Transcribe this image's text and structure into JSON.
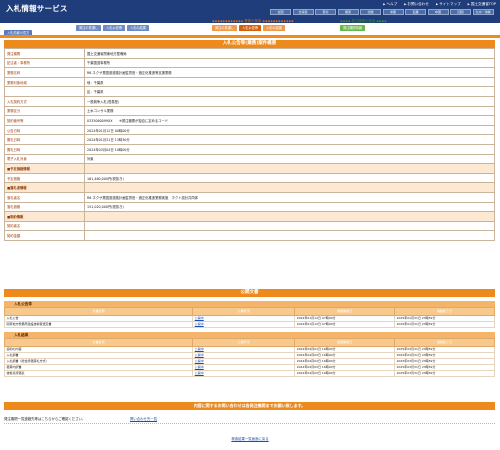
{
  "header": {
    "title": "入札情報サービス",
    "links": [
      "ヘルプ",
      "お問い合わせ",
      "サイトマップ",
      "国土交通省TOP"
    ],
    "regions": [
      "全国",
      "北海道",
      "東北",
      "関東",
      "北陸",
      "中部",
      "近畿",
      "中国",
      "四国",
      "九州・沖縄"
    ]
  },
  "nav": {
    "top_group": {
      "title": "★ 入札情報の見方 ★",
      "buttons": [
        "入札情報の見方"
      ]
    },
    "construction": {
      "title": "◆◆◆◆◆◆◆◆◆◆◆◆◆ 工事の検索 ◆◆◆◆◆◆◆◆◆◆◆◆◆",
      "buttons": [
        "発注の見通し",
        "入札公告等",
        "入札の結果"
      ]
    },
    "gyomu": {
      "title": "◆◆◆◆◆◆◆◆◆◆◆◆ 業務の検索 ◆◆◆◆◆◆◆◆◆◆◆◆",
      "buttons": [
        "発注の見通し",
        "入札公告等",
        "入札の結果"
      ],
      "selected": 1
    },
    "keiyaku": {
      "title": "◆◆◆◆ 発注機関の検索 ◆◆◆◆",
      "buttons": [
        "発注機関情報"
      ]
    }
  },
  "detail": {
    "title": "入札公告等(業務)案件概要",
    "rows": [
      {
        "label": "発注機関",
        "value": "国土交通省関東地方整備局",
        "section": false
      },
      {
        "label": "記注者・事務所",
        "value": "千葉国道事務所",
        "section": false
      },
      {
        "label": "業務名称",
        "value": "R6 ネクサ業図道道路計画監督官・適正化推進等支援業務",
        "section": false
      },
      {
        "label": "業務対象地域",
        "value": "他：千葉県",
        "section": false
      },
      {
        "label": "",
        "value": "区：千葉県",
        "section": false
      },
      {
        "label": "入札契約方式",
        "value": "一般競争入札(簡易型)",
        "section": false
      },
      {
        "label": "業務区分",
        "value": "土木コンサル業務",
        "section": false
      },
      {
        "label": "契約番号等",
        "value": "0333060099XX　　※発注機関が独自に定めるコード",
        "section": false
      },
      {
        "label": "公告日時",
        "value": "2024年01月12日 00時00分",
        "section": false
      },
      {
        "label": "開札日時",
        "value": "2024年01月31日 13時30分",
        "section": false
      },
      {
        "label": "開札日時",
        "value": "2024年03月04日 10時00分",
        "section": false
      },
      {
        "label": "電子入札対象",
        "value": "対象",
        "section": false
      },
      {
        "label": "■予定価格情報",
        "value": "",
        "section": true
      },
      {
        "label": "予定価格",
        "value": "161,460,000円(税抜き)",
        "section": false
      },
      {
        "label": "■落札者情報",
        "value": "",
        "section": true
      },
      {
        "label": "落札者名",
        "value": "R6 ネクサ業図道道路計画監督官・適正化推進業務実施　ホクト設計共同体",
        "section": false
      },
      {
        "label": "落札価格",
        "value": "151,020,000円(税抜き)",
        "section": false
      },
      {
        "label": "■契約情報",
        "value": "",
        "section": true
      },
      {
        "label": "契約者名",
        "value": "",
        "section": false
      },
      {
        "label": "契約金額",
        "value": "",
        "section": false
      }
    ]
  },
  "documents": {
    "title": "公開文書",
    "headers": [
      "文書名称",
      "公開状況",
      "掲載開始日",
      "掲載終了日"
    ],
    "groups": [
      {
        "name": "入札公告等",
        "rows": [
          [
            "入札公告",
            "公開中",
            "2024年01月12日 07時00分",
            "2025年01月31日 23時59分"
          ],
          [
            "関東地方整備局建設技術者選定書",
            "公開中",
            "2024年01月12日 07時00分",
            "2025年01月31日 23時59分"
          ]
        ]
      },
      {
        "name": "入札結果",
        "rows": [
          [
            "契約の内容",
            "公開中",
            "2024年04月01日 16時00分",
            "2025年03月31日 23時59分"
          ],
          [
            "入札調書",
            "公開中",
            "2024年04月02日 16時00分",
            "2025年03月31日 23時59分"
          ],
          [
            "入札調書（総合評価落札方式）",
            "公開中",
            "2024年04月02日 16時00分",
            "2025年03月31日 23時59分"
          ],
          [
            "積算内訳書",
            "公開中",
            "2024年04月02日 16時00分",
            "2025年03月31日 23時59分"
          ],
          [
            "技術点評価表",
            "公開中",
            "2024年04月02日 16時00分",
            "2025年03月31日 23時59分"
          ]
        ]
      }
    ]
  },
  "inquiry": {
    "title": "内容に関するお問い合わせは各発注機関までお願い致します。",
    "text": "発注機関一覧連絡先等はこちらからご確認ください。",
    "link": "問い合わせ先一覧"
  },
  "back_link": "検索結果一覧画面に戻る"
}
